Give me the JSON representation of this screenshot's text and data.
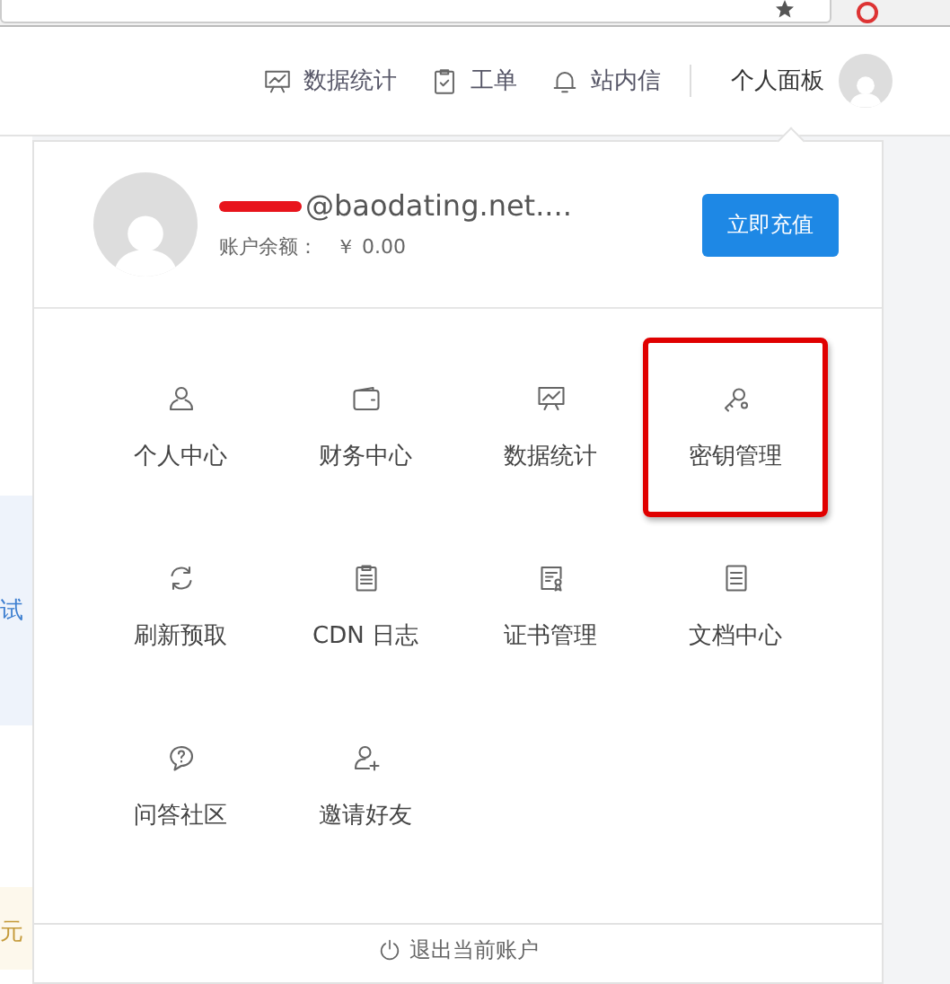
{
  "nav": {
    "items": [
      {
        "label": "数据统计",
        "kind": "chart"
      },
      {
        "label": "工单",
        "kind": "ticket"
      },
      {
        "label": "站内信",
        "kind": "bell"
      }
    ],
    "panel_label": "个人面板"
  },
  "background": {
    "fragments": [
      {
        "text": "试",
        "kind": "link"
      },
      {
        "text": "元",
        "kind": "price"
      }
    ]
  },
  "dropdown": {
    "account": {
      "email": "@baodating.net....",
      "email_redacted": true,
      "balance_label": "账户余额：",
      "balance": "￥ 0.00",
      "recharge_button": "立即充值"
    },
    "menu": [
      {
        "label": "个人中心",
        "kind": "user",
        "highlighted": false
      },
      {
        "label": "财务中心",
        "kind": "wallet",
        "highlighted": false
      },
      {
        "label": "数据统计",
        "kind": "chart",
        "highlighted": false
      },
      {
        "label": "密钥管理",
        "kind": "key",
        "highlighted": true
      },
      {
        "label": "刷新预取",
        "kind": "refresh",
        "highlighted": false
      },
      {
        "label": "CDN 日志",
        "kind": "clipboard",
        "highlighted": false
      },
      {
        "label": "证书管理",
        "kind": "certificate",
        "highlighted": false
      },
      {
        "label": "文档中心",
        "kind": "document",
        "highlighted": false
      },
      {
        "label": "问答社区",
        "kind": "question",
        "highlighted": false
      },
      {
        "label": "邀请好友",
        "kind": "user-plus",
        "highlighted": false
      }
    ],
    "logout": "退出当前账户"
  }
}
